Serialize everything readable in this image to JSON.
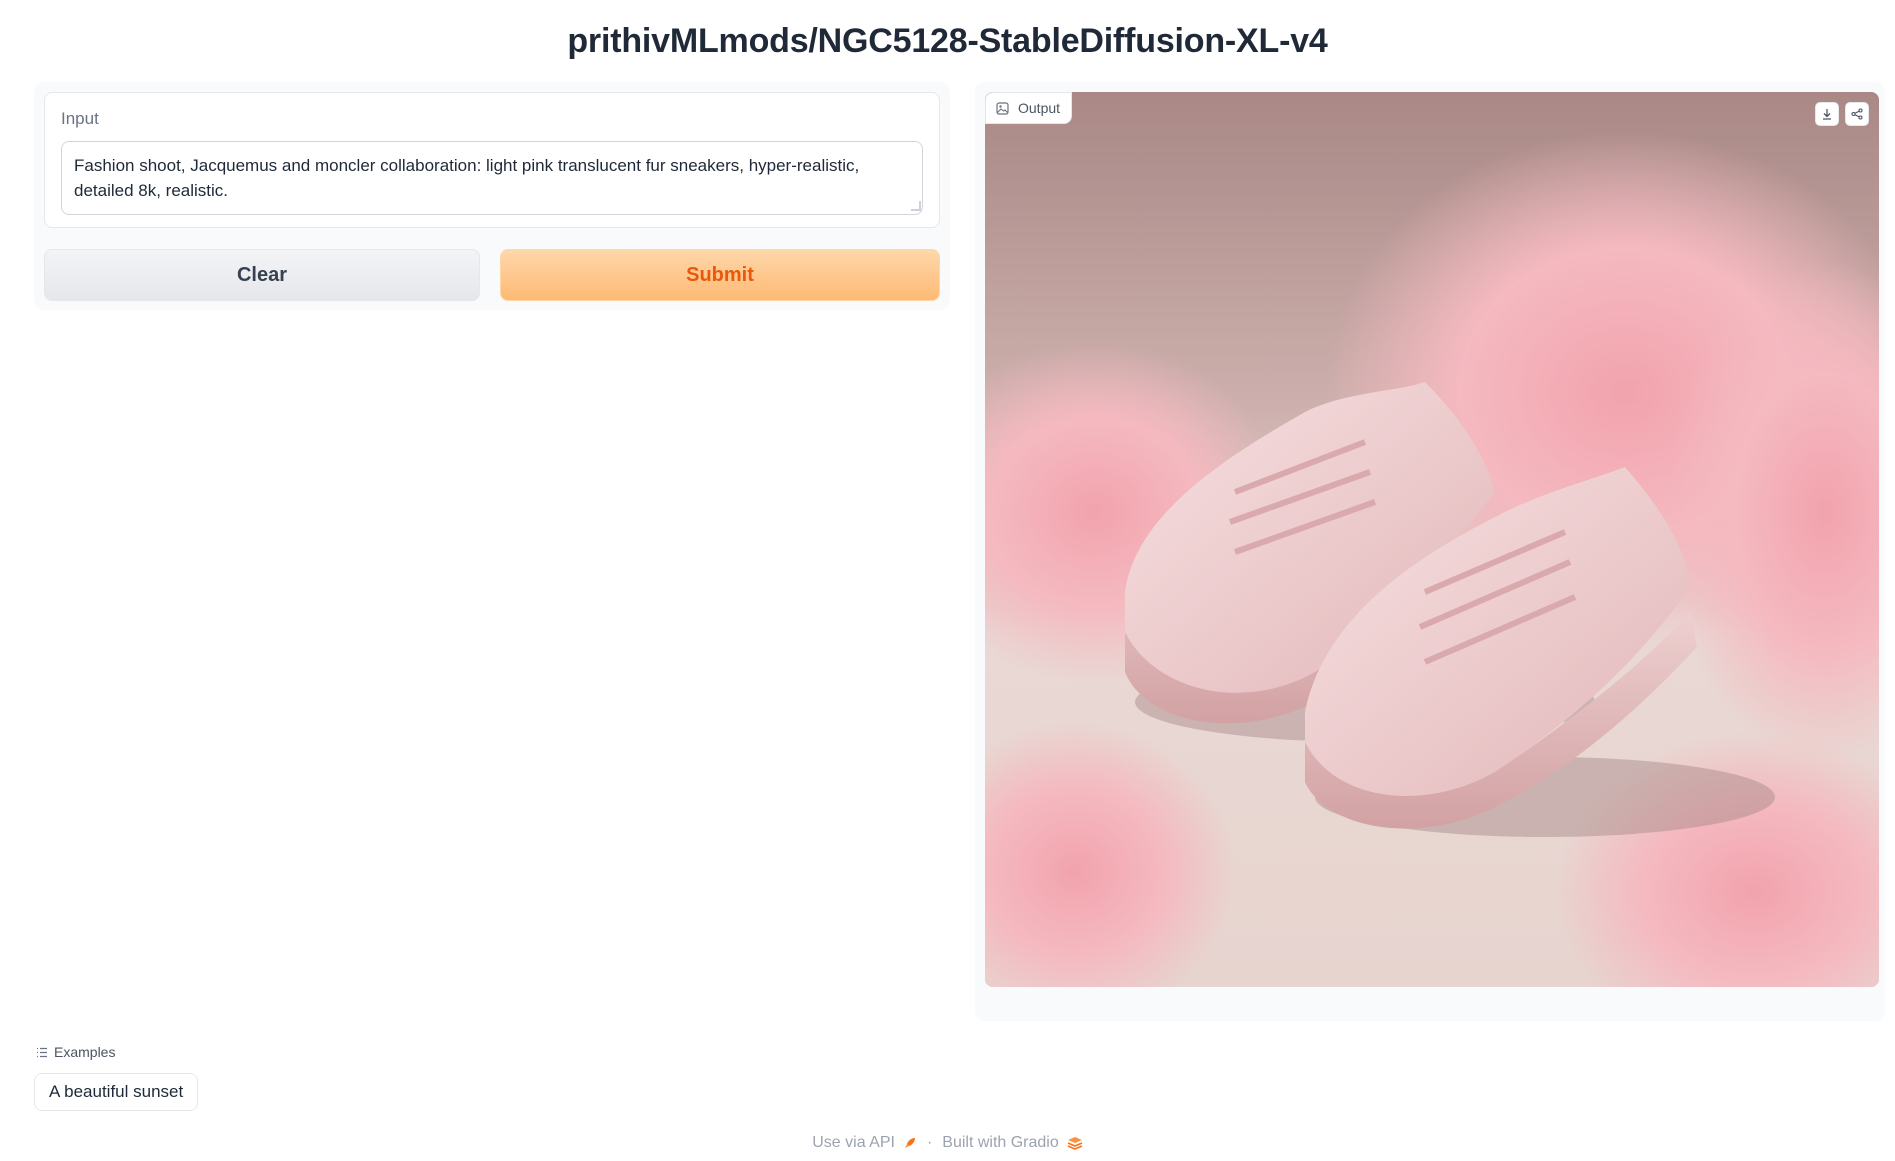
{
  "header": {
    "title": "prithivMLmods/NGC5128-StableDiffusion-XL-v4"
  },
  "input": {
    "label": "Input",
    "value": "Fashion shoot, Jacquemus and moncler collaboration: light pink translucent fur sneakers, hyper-realistic, detailed 8k, realistic."
  },
  "buttons": {
    "clear_label": "Clear",
    "submit_label": "Submit"
  },
  "output": {
    "label": "Output",
    "image_icon": "image-icon",
    "download_icon": "download-icon",
    "share_icon": "share-icon"
  },
  "examples": {
    "label": "Examples",
    "items": [
      "A beautiful sunset"
    ]
  },
  "footer": {
    "api_label": "Use via API",
    "separator": "·",
    "built_label": "Built with Gradio"
  },
  "colors": {
    "accent": "#ea580c",
    "submit_bg": "#fdba74",
    "panel_bg": "#f9fafb"
  }
}
